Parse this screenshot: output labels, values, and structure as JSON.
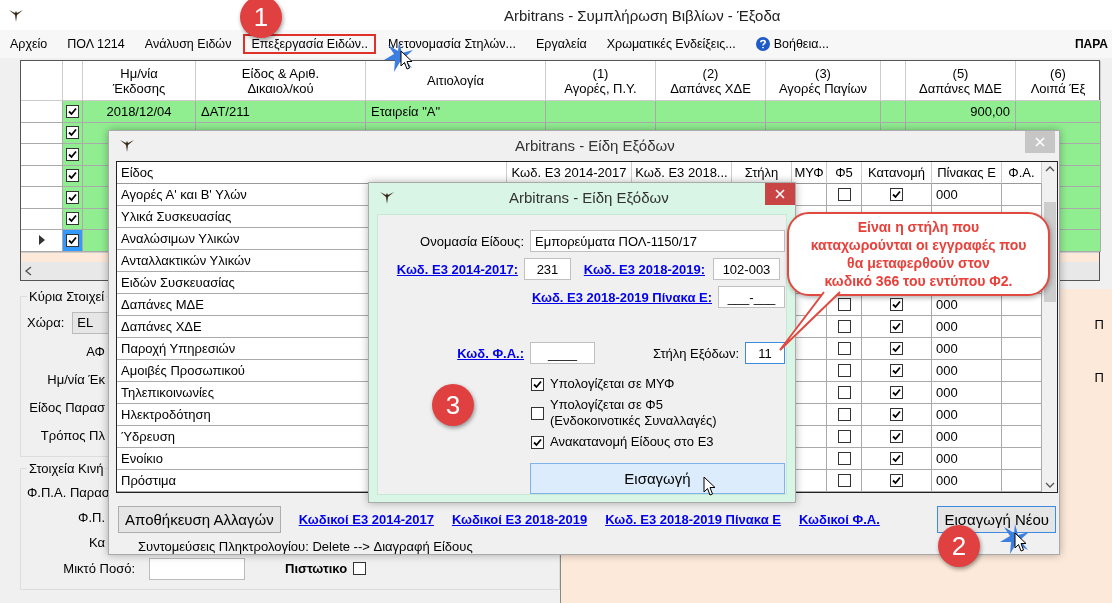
{
  "main_window": {
    "title": "Arbitrans - Συμπλήρωση Βιβλίων - Έξοδα",
    "menu": [
      {
        "label": "Αρχείο",
        "kind": "plain",
        "highlighted": false
      },
      {
        "label": "ΠΟΛ 1214",
        "kind": "plain",
        "highlighted": false
      },
      {
        "label": "Ανάλυση Ειδών",
        "kind": "plain",
        "highlighted": false
      },
      {
        "label": "Επεξεργασία Ειδών..",
        "kind": "plain",
        "highlighted": true
      },
      {
        "label": "Μετονομασία Στηλών...",
        "kind": "plain",
        "highlighted": false
      },
      {
        "label": "Εργαλεία",
        "kind": "plain",
        "highlighted": false
      },
      {
        "label": "Χρωματικές Ενδείξεις...",
        "kind": "plain",
        "highlighted": false
      },
      {
        "label": "Βοήθεια...",
        "kind": "help",
        "highlighted": false
      }
    ],
    "menu_right": "ΠΑΡΑ",
    "grid": {
      "columns": [
        {
          "kind": "check"
        },
        {
          "kind": "date",
          "label": "Ημ/νία\nΈκδοσης"
        },
        {
          "kind": "document",
          "label": "Είδος & Αριθ.\nΔικαιολ/κού"
        },
        {
          "kind": "reason",
          "label": "Αιτιολογία"
        },
        {
          "kind": "amount",
          "label": "(1)\nΑγορές, Π.Υ."
        },
        {
          "kind": "amount",
          "label": "(2)\nΔαπάνες ΧΔΕ"
        },
        {
          "kind": "amount",
          "label": "(3)\nΑγορές Παγίων"
        },
        {
          "kind": "blank"
        },
        {
          "kind": "mde",
          "label": "(5)\nΔαπάνες ΜΔΕ"
        },
        {
          "kind": "amount",
          "label": "(6)\nΛοιπά Έξ"
        }
      ],
      "rows": [
        {
          "checked": true,
          "current": false,
          "date": "2018/12/04",
          "document": "ΔΑΤ/211",
          "reason": "Εταιρεία \"Α\"",
          "mde": "900,00"
        },
        {
          "checked": true,
          "current": false
        },
        {
          "checked": true,
          "current": false
        },
        {
          "checked": true,
          "current": false
        },
        {
          "checked": true,
          "current": false
        },
        {
          "checked": true,
          "current": false
        },
        {
          "checked": true,
          "current": true
        }
      ]
    },
    "main_info": {
      "legend": "Κύρια Στοιχεί",
      "country_label": "Χώρα:",
      "country_value": "EL",
      "labels": [
        "ΑΦ",
        "Ημ/νία Έκ",
        "Είδος Παρασ",
        "Τρόπος Πλ"
      ]
    },
    "movement_info": {
      "legend": "Στοιχεία Κινή",
      "labels": [
        "Φ.Π.Α. Παρασ",
        "Φ.Π.",
        "Κα"
      ],
      "gross_label": "Μικτό Ποσό:",
      "credit_label": "Πιστωτικο",
      "credit_checked": false
    },
    "side_labels": [
      "Π",
      "Π"
    ]
  },
  "items_dialog": {
    "title": "Arbitrans - Είδη Εξόδων",
    "columns": [
      {
        "kind": "name",
        "label": "Είδος"
      },
      {
        "kind": "empty",
        "label": "Κωδ. Ε3 2014-2017"
      },
      {
        "kind": "empty",
        "label": "Κωδ. Ε3 2018..."
      },
      {
        "kind": "empty",
        "label": "Στήλη"
      },
      {
        "kind": "empty",
        "label": "ΜΥΦ"
      },
      {
        "kind": "f5",
        "label": "Φ5"
      },
      {
        "kind": "allocation",
        "label": "Κατανομή"
      },
      {
        "kind": "table_e",
        "label": "Πίνακας Ε"
      },
      {
        "kind": "empty",
        "label": "Φ.Α."
      }
    ],
    "rows": [
      {
        "name": "Αγορές Α' και Β' Υλών",
        "f5": false,
        "allocation": true,
        "table_e": "000"
      },
      {
        "name": "Υλικά Συσκευασίας"
      },
      {
        "name": "Αναλώσιμων Υλικών"
      },
      {
        "name": "Ανταλλακτικών Υλικών"
      },
      {
        "name": "Ειδών Συσκευασίας"
      },
      {
        "name": "Δαπάνες ΜΔΕ",
        "f5": false,
        "allocation": true,
        "table_e": "000"
      },
      {
        "name": "Δαπάνες ΧΔΕ",
        "f5": false,
        "allocation": true,
        "table_e": "000"
      },
      {
        "name": "Παροχή Υπηρεσιών",
        "f5": false,
        "allocation": true,
        "table_e": "000"
      },
      {
        "name": "Αμοιβές Προσωπικού",
        "f5": false,
        "allocation": true,
        "table_e": "000"
      },
      {
        "name": "Τηλεπικοινωνίες",
        "f5": false,
        "allocation": true,
        "table_e": "000"
      },
      {
        "name": "Ηλεκτροδότηση",
        "f5": false,
        "allocation": true,
        "table_e": "000"
      },
      {
        "name": "Ύδρευση",
        "f5": false,
        "allocation": true,
        "table_e": "000"
      },
      {
        "name": "Ενοίκιο",
        "f5": false,
        "allocation": true,
        "table_e": "000"
      },
      {
        "name": "Πρόστιμα",
        "f5": false,
        "allocation": true,
        "table_e": "000"
      }
    ],
    "save_button": "Αποθήκευση Αλλαγών",
    "links": [
      "Κωδικοί Ε3 2014-2017",
      "Κωδικοί Ε3 2018-2019",
      "Κωδ. Ε3 2018-2019 Πίνακα Ε",
      "Κωδικοί Φ.Α."
    ],
    "new_button": "Εισαγωγή Νέου",
    "shortcuts": "Συντομεύσεις Πληκτρολογίου: Delete --> Διαγραφή Είδους"
  },
  "edit_dialog": {
    "title": "Arbitrans - Είδη Εξόδων",
    "name_label": "Ονομασία Είδους:",
    "name_value": "Εμπορεύματα ΠΟΛ-1150/17",
    "e3_2014_label": "Κωδ. Ε3 2014-2017:",
    "e3_2014_value": "231",
    "e3_2018_label": "Κωδ. Ε3 2018-2019:",
    "e3_2018_value": "102-003",
    "table_e_label": "Κωδ. Ε3 2018-2019 Πίνακα Ε:",
    "table_e_value": "___-___",
    "vat_label": "Κωδ. Φ.Α.:",
    "vat_value": "____",
    "column_label": "Στήλη Εξόδων:",
    "column_value": "11",
    "options": [
      {
        "label": "Υπολογίζεται σε ΜΥΦ",
        "checked": true
      },
      {
        "label": "Υπολογίζεται σε Φ5\n(Ενδοκοινοτικές Συναλλαγές)",
        "checked": false
      },
      {
        "label": "Ανακατανομή Είδους στο Ε3",
        "checked": true
      }
    ],
    "submit_button": "Εισαγωγή"
  },
  "callout": "Είναι η στήλη που\nκαταχωρούνται οι εγγραφές που\nθα μεταφερθούν στον\nκωδικό 366 του εντύπου Φ2.",
  "step_badges": [
    "1",
    "2",
    "3"
  ]
}
